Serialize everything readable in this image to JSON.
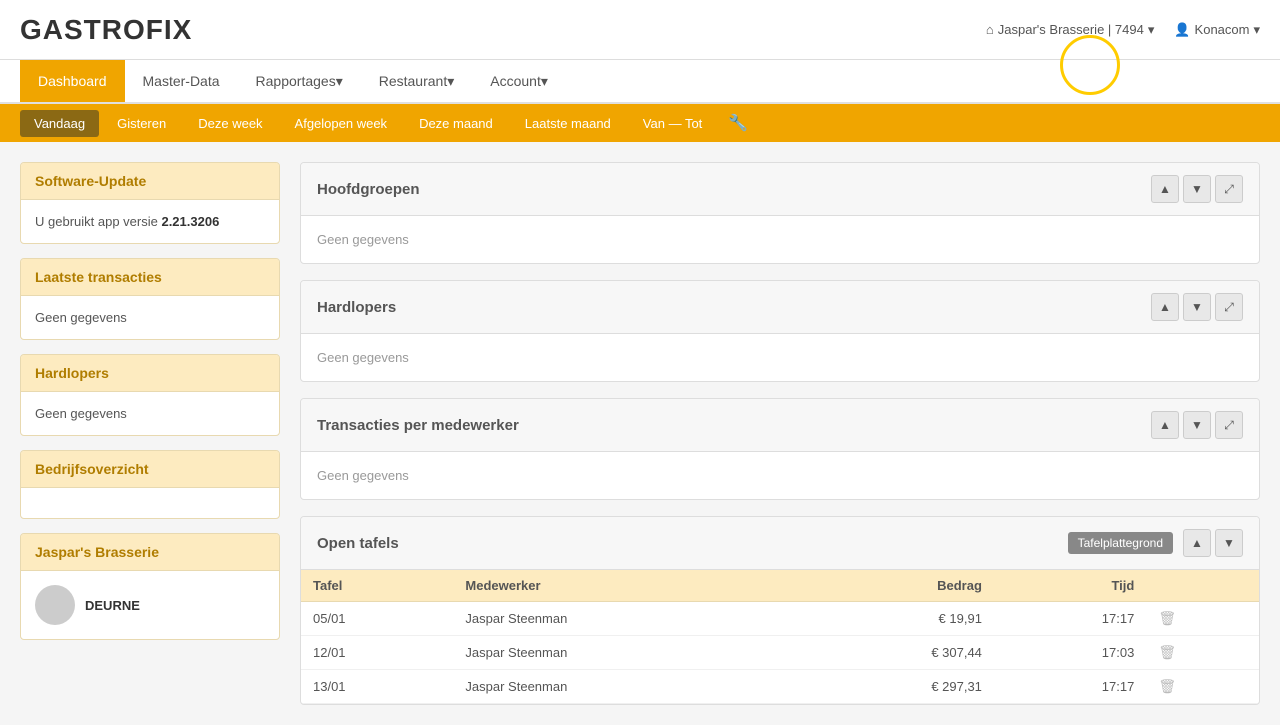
{
  "logo": "GASTROFIX",
  "header": {
    "restaurant": "Jaspar's Brasserie | 7494",
    "user": "Konacom",
    "restaurant_icon": "🏠",
    "user_icon": "👤"
  },
  "nav": {
    "items": [
      {
        "label": "Dashboard",
        "active": true,
        "has_arrow": false
      },
      {
        "label": "Master-Data",
        "active": false,
        "has_arrow": false
      },
      {
        "label": "Rapportages",
        "active": false,
        "has_arrow": true
      },
      {
        "label": "Restaurant",
        "active": false,
        "has_arrow": true
      },
      {
        "label": "Account",
        "active": false,
        "has_arrow": true
      }
    ]
  },
  "subnav": {
    "items": [
      {
        "label": "Vandaag",
        "active": true
      },
      {
        "label": "Gisteren",
        "active": false
      },
      {
        "label": "Deze week",
        "active": false
      },
      {
        "label": "Afgelopen week",
        "active": false
      },
      {
        "label": "Deze maand",
        "active": false
      },
      {
        "label": "Laatste maand",
        "active": false
      },
      {
        "label": "Van — Tot",
        "active": false
      }
    ],
    "settings_icon": "🔧"
  },
  "sidebar": {
    "cards": [
      {
        "id": "software-update",
        "title": "Software-Update",
        "body_text": "U gebruikt app versie",
        "version": "2.21.3206"
      },
      {
        "id": "laatste-transacties",
        "title": "Laatste transacties",
        "body_text": "Geen gegevens",
        "version": null
      },
      {
        "id": "hardlopers",
        "title": "Hardlopers",
        "body_text": "Geen gegevens",
        "version": null
      },
      {
        "id": "bedrijfsoverzicht",
        "title": "Bedrijfsoverzicht",
        "body_text": "",
        "version": null
      },
      {
        "id": "jaspars-brasserie",
        "title": "Jaspar's Brasserie",
        "body_text": "DEURNE",
        "version": null
      }
    ]
  },
  "widgets": [
    {
      "id": "hoofdgroepen",
      "title": "Hoofdgroepen",
      "body_text": "Geen gegevens",
      "has_expand": true
    },
    {
      "id": "hardlopers",
      "title": "Hardlopers",
      "body_text": "Geen gegevens",
      "has_expand": true
    },
    {
      "id": "transacties-per-medewerker",
      "title": "Transacties per medewerker",
      "body_text": "Geen gegevens",
      "has_expand": true
    }
  ],
  "open_tafels": {
    "title": "Open tafels",
    "tafelplattegrond_label": "Tafelplattegrond",
    "columns": [
      {
        "key": "tafel",
        "label": "Tafel"
      },
      {
        "key": "medewerker",
        "label": "Medewerker"
      },
      {
        "key": "bedrag",
        "label": "Bedrag"
      },
      {
        "key": "tijd",
        "label": "Tijd"
      }
    ],
    "rows": [
      {
        "tafel": "05/01",
        "medewerker": "Jaspar Steenman",
        "bedrag": "€ 19,91",
        "tijd": "17:17"
      },
      {
        "tafel": "12/01",
        "medewerker": "Jaspar Steenman",
        "bedrag": "€ 307,44",
        "tijd": "17:03"
      },
      {
        "tafel": "13/01",
        "medewerker": "Jaspar Steenman",
        "bedrag": "€ 297,31",
        "tijd": "17:17"
      }
    ]
  },
  "icons": {
    "up": "▲",
    "down": "▼",
    "expand": "⤢",
    "delete": "🗑",
    "wrench": "🔧",
    "home": "⌂",
    "user": "👤",
    "arrow_down": "▾"
  }
}
